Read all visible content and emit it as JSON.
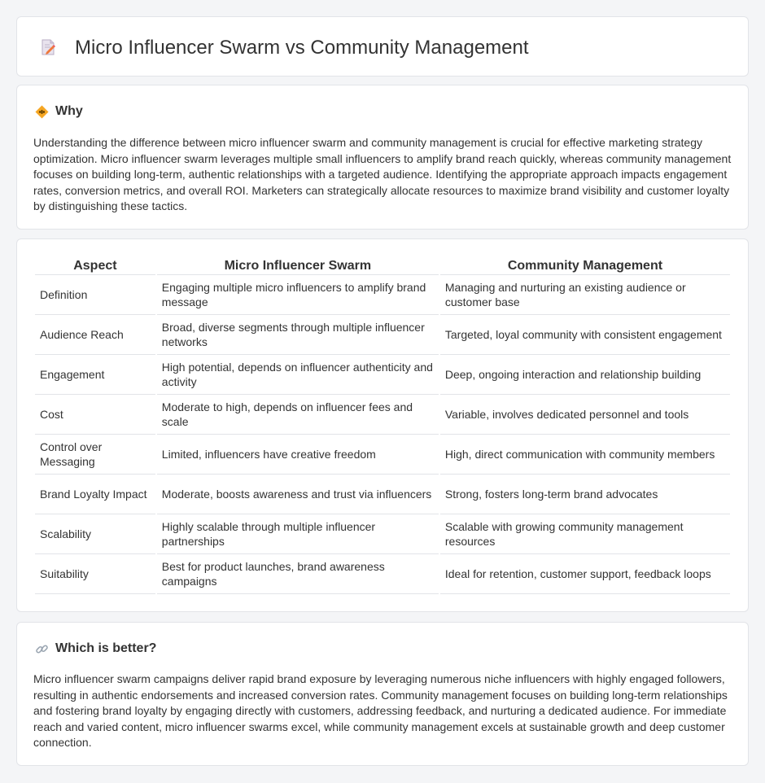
{
  "header": {
    "title": "Micro Influencer Swarm vs Community Management",
    "icon": "document-edit-icon"
  },
  "why": {
    "icon": "diamond-warning-icon",
    "heading": "Why",
    "text": "Understanding the difference between micro influencer swarm and community management is crucial for effective marketing strategy optimization. Micro influencer swarm leverages multiple small influencers to amplify brand reach quickly, whereas community management focuses on building long-term, authentic relationships with a targeted audience. Identifying the appropriate approach impacts engagement rates, conversion metrics, and overall ROI. Marketers can strategically allocate resources to maximize brand visibility and customer loyalty by distinguishing these tactics."
  },
  "comparison": {
    "headers": [
      "Aspect",
      "Micro Influencer Swarm",
      "Community Management"
    ],
    "rows": [
      [
        "Definition",
        "Engaging multiple micro influencers to amplify brand message",
        "Managing and nurturing an existing audience or customer base"
      ],
      [
        "Audience Reach",
        "Broad, diverse segments through multiple influencer networks",
        "Targeted, loyal community with consistent engagement"
      ],
      [
        "Engagement",
        "High potential, depends on influencer authenticity and activity",
        "Deep, ongoing interaction and relationship building"
      ],
      [
        "Cost",
        "Moderate to high, depends on influencer fees and scale",
        "Variable, involves dedicated personnel and tools"
      ],
      [
        "Control over Messaging",
        "Limited, influencers have creative freedom",
        "High, direct communication with community members"
      ],
      [
        "Brand Loyalty Impact",
        "Moderate, boosts awareness and trust via influencers",
        "Strong, fosters long-term brand advocates"
      ],
      [
        "Scalability",
        "Highly scalable through multiple influencer partnerships",
        "Scalable with growing community management resources"
      ],
      [
        "Suitability",
        "Best for product launches, brand awareness campaigns",
        "Ideal for retention, customer support, feedback loops"
      ]
    ]
  },
  "better": {
    "icon": "link-icon",
    "heading": "Which is better?",
    "text": "Micro influencer swarm campaigns deliver rapid brand exposure by leveraging numerous niche influencers with highly engaged followers, resulting in authentic endorsements and increased conversion rates. Community management focuses on building long-term relationships and fostering brand loyalty by engaging directly with customers, addressing feedback, and nurturing a dedicated audience. For immediate reach and varied content, micro influencer swarms excel, while community management excels at sustainable growth and deep customer connection."
  },
  "colors": {
    "background": "#f4f5f7",
    "card": "#ffffff",
    "border": "#e2e4e8",
    "text": "#333333",
    "accent_orange": "#f5a623"
  }
}
